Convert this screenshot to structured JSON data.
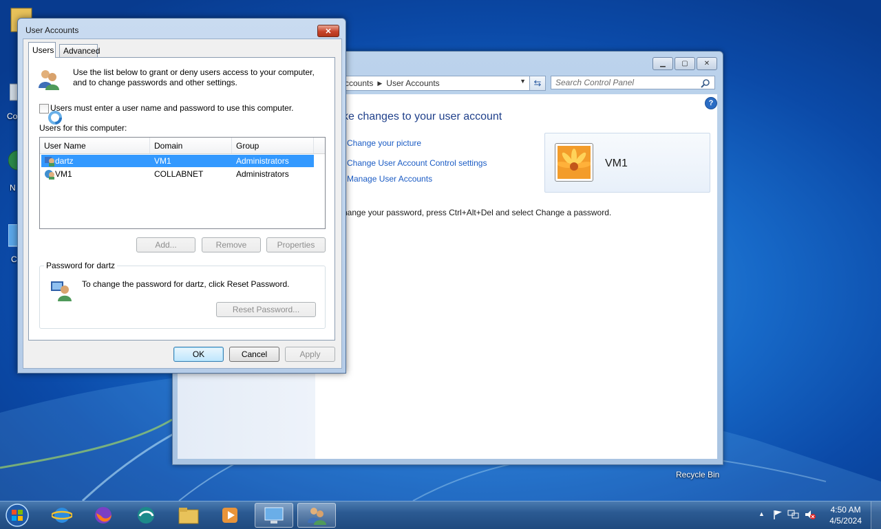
{
  "desktop": {
    "icons": [
      {
        "name": "computer",
        "label": "Co"
      },
      {
        "name": "network",
        "label": "N"
      },
      {
        "name": "control-panel",
        "label": "C"
      },
      {
        "name": "recycle-bin",
        "label": "Recycle Bin"
      }
    ]
  },
  "control_panel": {
    "breadcrumb_prefix": "ccounts",
    "breadcrumb_current": "User Accounts",
    "search_placeholder": "Search Control Panel",
    "heading": "ke changes to your user account",
    "links": [
      "Change your picture",
      "Change User Account Control settings",
      "Manage User Accounts"
    ],
    "user_name": "VM1",
    "password_hint": "hange your password, press Ctrl+Alt+Del and select Change a password."
  },
  "dialog": {
    "title": "User Accounts",
    "tabs": [
      "Users",
      "Advanced"
    ],
    "intro_line1": "Use the list below to grant or deny users access to your computer,",
    "intro_line2": "and to change passwords and other settings.",
    "require_login_label": "Users must enter a user name and password to use this computer.",
    "require_login_checked": false,
    "users_label": "Users for this computer:",
    "columns": [
      "User Name",
      "Domain",
      "Group"
    ],
    "rows": [
      {
        "user": "dartz",
        "domain": "VM1",
        "group": "Administrators",
        "selected": true
      },
      {
        "user": "VM1",
        "domain": "COLLABNET",
        "group": "Administrators",
        "selected": false
      }
    ],
    "buttons": {
      "add": "Add...",
      "remove": "Remove",
      "properties": "Properties"
    },
    "password_group_label": "Password for dartz",
    "password_text": "To change the password for dartz, click Reset Password.",
    "reset_password": "Reset Password...",
    "ok": "OK",
    "cancel": "Cancel",
    "apply": "Apply"
  },
  "taskbar": {
    "clock_time": "4:50 AM",
    "clock_date": "4/5/2024"
  }
}
